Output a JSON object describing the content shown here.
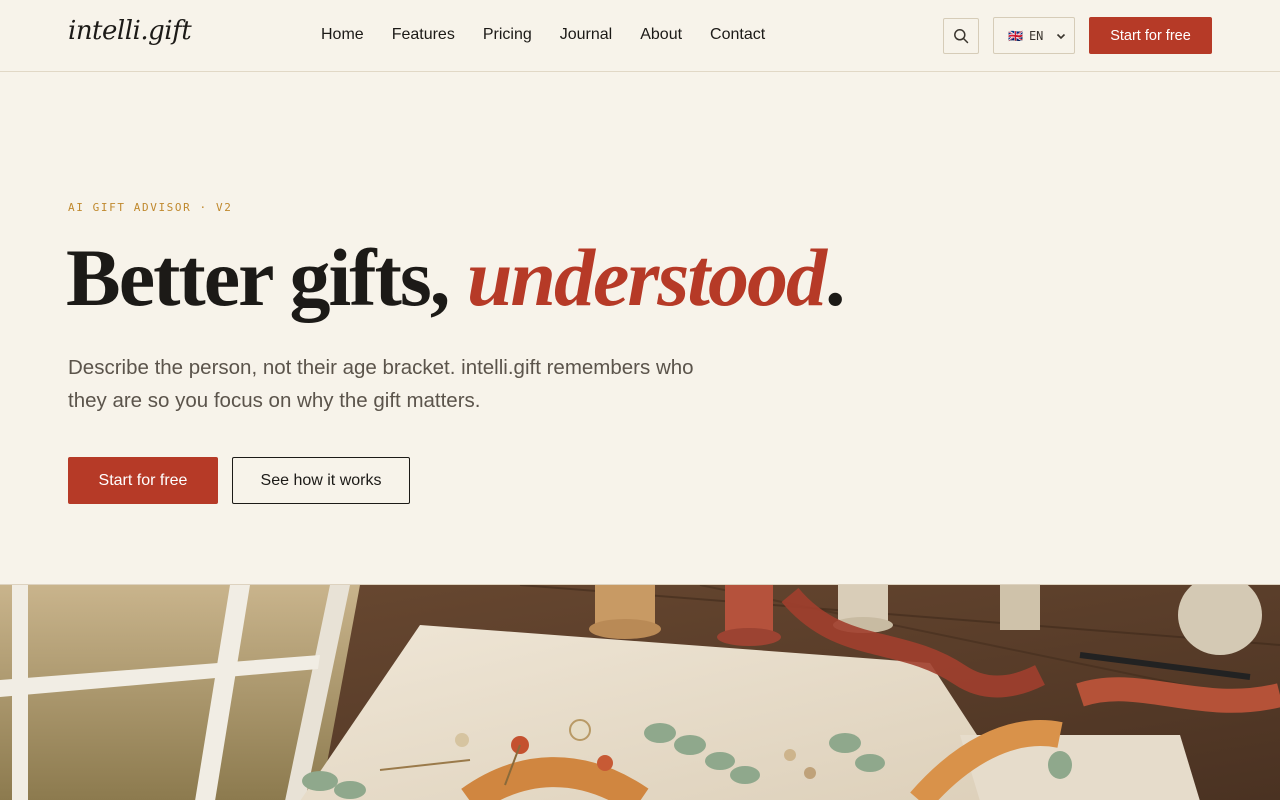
{
  "header": {
    "logo": "intelli.gift",
    "nav": [
      "Home",
      "Features",
      "Pricing",
      "Journal",
      "About",
      "Contact"
    ],
    "search_icon": "search-icon",
    "language": {
      "flag": "🇬🇧",
      "code": "EN"
    },
    "cta_label": "Start for free"
  },
  "hero": {
    "eyebrow": "AI GIFT ADVISOR · V2",
    "headline_plain": "Better gifts, ",
    "headline_accent": "understood",
    "headline_end": ".",
    "subtitle": "Describe the person, not their age bracket. intelli.gift remembers who they are so you focus on why the gift matters.",
    "primary_cta": "Start for free",
    "secondary_cta": "See how it works"
  },
  "colors": {
    "background": "#f7f3ea",
    "accent": "#b63a27",
    "eyebrow": "#c0892e",
    "text": "#1c1a17"
  }
}
